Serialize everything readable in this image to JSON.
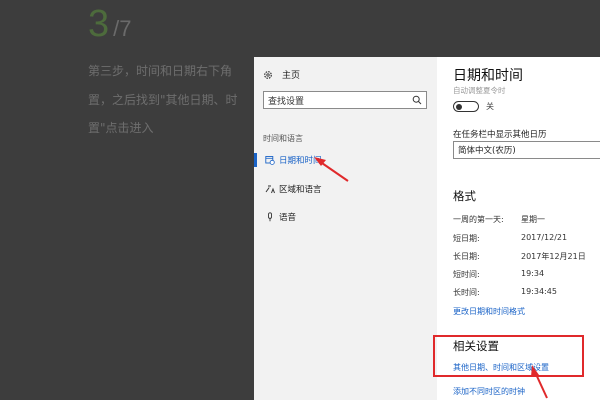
{
  "tutorial": {
    "step_number": "3",
    "step_total": "/7",
    "lines": [
      "第三步，时间和日期右下角",
      "置，之后找到\"其他日期、时",
      "置\"点击进入"
    ]
  },
  "nav": {
    "home": "主页",
    "search_placeholder": "查找设置",
    "section": "时间和语言",
    "items": [
      {
        "label": "日期和时间",
        "icon": "calendar-clock-icon"
      },
      {
        "label": "区域和语言",
        "icon": "region-language-icon"
      },
      {
        "label": "语音",
        "icon": "microphone-icon"
      }
    ]
  },
  "main": {
    "title": "日期和时间",
    "auto_dst": "自动调整夏令时",
    "toggle_state": "关",
    "taskbar_label": "在任务栏中显示其他日历",
    "calendar_value": "简体中文(农历)",
    "format_heading": "格式",
    "formats": [
      {
        "key": "一周的第一天:",
        "value": "星期一"
      },
      {
        "key": "短日期:",
        "value": "2017/12/21"
      },
      {
        "key": "长日期:",
        "value": "2017年12月21日"
      },
      {
        "key": "短时间:",
        "value": "19:34"
      },
      {
        "key": "长时间:",
        "value": "19:34:45"
      }
    ],
    "change_formats_link": "更改日期和时间格式",
    "related_heading": "相关设置",
    "other_settings_link": "其他日期、时间和区域设置",
    "add_clocks_link": "添加不同时区的时钟"
  },
  "colors": {
    "accent": "#1a63c7",
    "annotation": "#e0292b"
  }
}
